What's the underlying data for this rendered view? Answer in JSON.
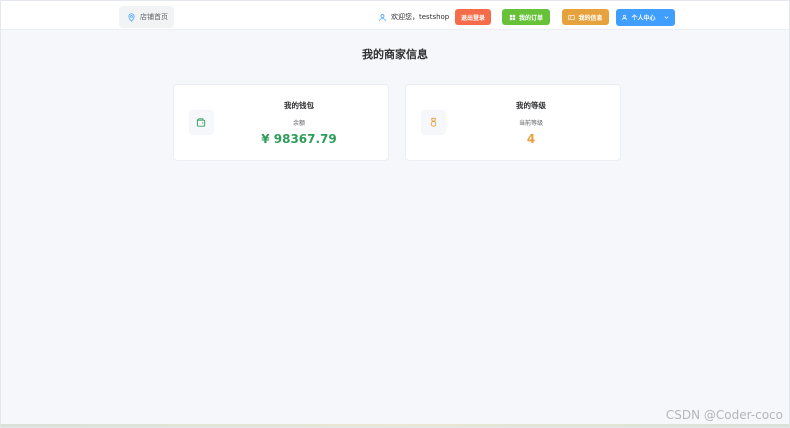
{
  "header": {
    "home_label": "店铺首页",
    "welcome_text": "欢迎您，testshop",
    "logout_label": "退出登录",
    "orders_label": "我的订单",
    "info_label": "我的信息",
    "center_label": "个人中心"
  },
  "main": {
    "title": "我的商家信息",
    "wallet": {
      "title": "我的钱包",
      "label": "余额",
      "value": "¥ 98367.79"
    },
    "level": {
      "title": "我的等级",
      "label": "当前等级",
      "value": "4"
    }
  },
  "watermark": "CSDN @Coder-coco",
  "icons": {
    "home": "location-pin-icon",
    "user": "user-icon",
    "orders": "grid-icon",
    "info": "card-icon",
    "center": "user-icon",
    "dropdown": "chevron-down-icon",
    "wallet": "wallet-icon",
    "level": "medal-icon"
  },
  "colors": {
    "logout": "#f56c4a",
    "orders": "#67c23a",
    "info": "#e6a23c",
    "center": "#409eff",
    "balance": "#2e9d5a",
    "level": "#e6a23c"
  }
}
